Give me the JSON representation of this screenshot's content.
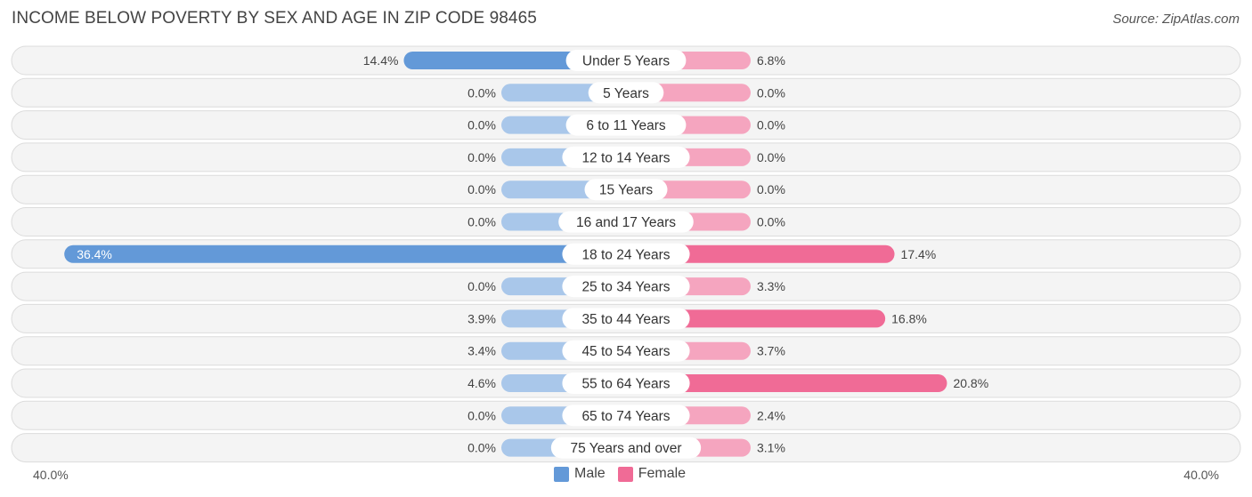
{
  "header": {
    "title": "INCOME BELOW POVERTY BY SEX AND AGE IN ZIP CODE 98465",
    "source": "Source: ZipAtlas.com"
  },
  "colors": {
    "male_strong": "#6399d8",
    "male_light": "#a9c7ea",
    "female_strong": "#f06b96",
    "female_light": "#f5a5bf",
    "row_bg": "#f4f4f4"
  },
  "chart_data": {
    "type": "bar",
    "orientation": "horizontal-diverging",
    "title": "INCOME BELOW POVERTY BY SEX AND AGE IN ZIP CODE 98465",
    "categories": [
      "Under 5 Years",
      "5 Years",
      "6 to 11 Years",
      "12 to 14 Years",
      "15 Years",
      "16 and 17 Years",
      "18 to 24 Years",
      "25 to 34 Years",
      "35 to 44 Years",
      "45 to 54 Years",
      "55 to 64 Years",
      "65 to 74 Years",
      "75 Years and over"
    ],
    "series": [
      {
        "name": "Male",
        "values": [
          14.4,
          0.0,
          0.0,
          0.0,
          0.0,
          0.0,
          36.4,
          0.0,
          3.9,
          3.4,
          4.6,
          0.0,
          0.0
        ]
      },
      {
        "name": "Female",
        "values": [
          6.8,
          0.0,
          0.0,
          0.0,
          0.0,
          0.0,
          17.4,
          3.3,
          16.8,
          3.7,
          20.8,
          2.4,
          3.1
        ]
      }
    ],
    "value_labels": {
      "male": [
        "14.4%",
        "0.0%",
        "0.0%",
        "0.0%",
        "0.0%",
        "0.0%",
        "36.4%",
        "0.0%",
        "3.9%",
        "3.4%",
        "4.6%",
        "0.0%",
        "0.0%"
      ],
      "female": [
        "6.8%",
        "0.0%",
        "0.0%",
        "0.0%",
        "0.0%",
        "0.0%",
        "17.4%",
        "3.3%",
        "16.8%",
        "3.7%",
        "20.8%",
        "2.4%",
        "3.1%"
      ]
    },
    "xlim": [
      -40,
      40
    ],
    "axis_labels": {
      "left": "40.0%",
      "right": "40.0%"
    },
    "legend": {
      "position": "bottom-center",
      "items": [
        "Male",
        "Female"
      ]
    },
    "units": "%",
    "grid": false
  }
}
